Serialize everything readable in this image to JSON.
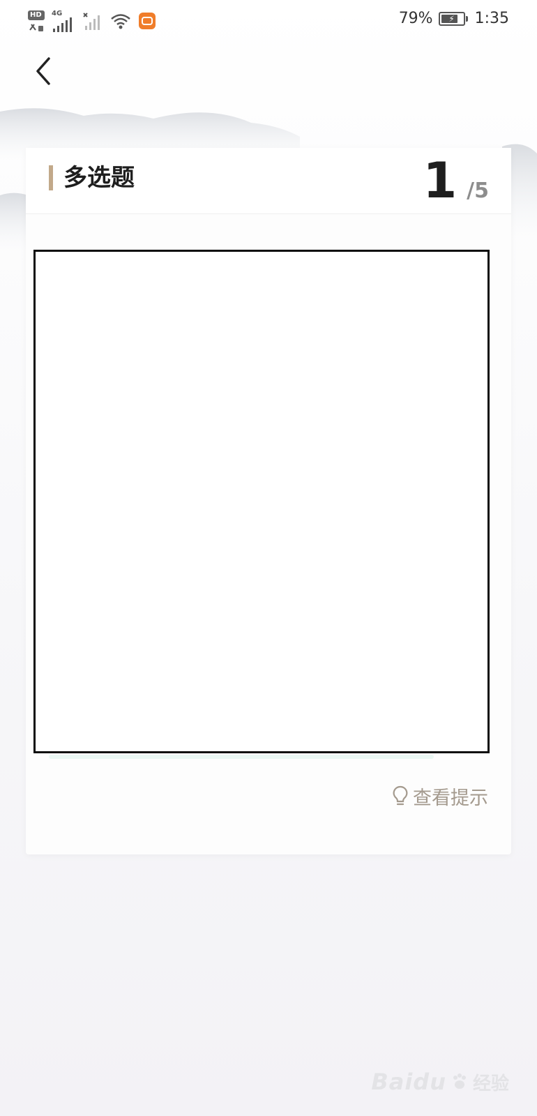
{
  "status_bar": {
    "hd_label": "HD",
    "network_label": "4G",
    "battery_percent": "79%",
    "battery_level": 0.79,
    "time": "1:35",
    "icons": [
      "signal-icon",
      "wifi-icon",
      "app-notification-icon",
      "battery-icon"
    ]
  },
  "nav": {
    "back_icon": "chevron-left-icon"
  },
  "question_card": {
    "type_label": "多选题",
    "current": "1",
    "total": "/5"
  },
  "hint": {
    "icon": "lightbulb-icon",
    "label": "查看提示"
  },
  "watermark": {
    "brand": "Baidu",
    "sub": "经验"
  },
  "colors": {
    "accent": "#c2a98a",
    "hint_text": "#a49a8e",
    "title_text": "#1e1e1e",
    "muted_text": "#8d8d8d",
    "notification_orange": "#f07d2a"
  }
}
